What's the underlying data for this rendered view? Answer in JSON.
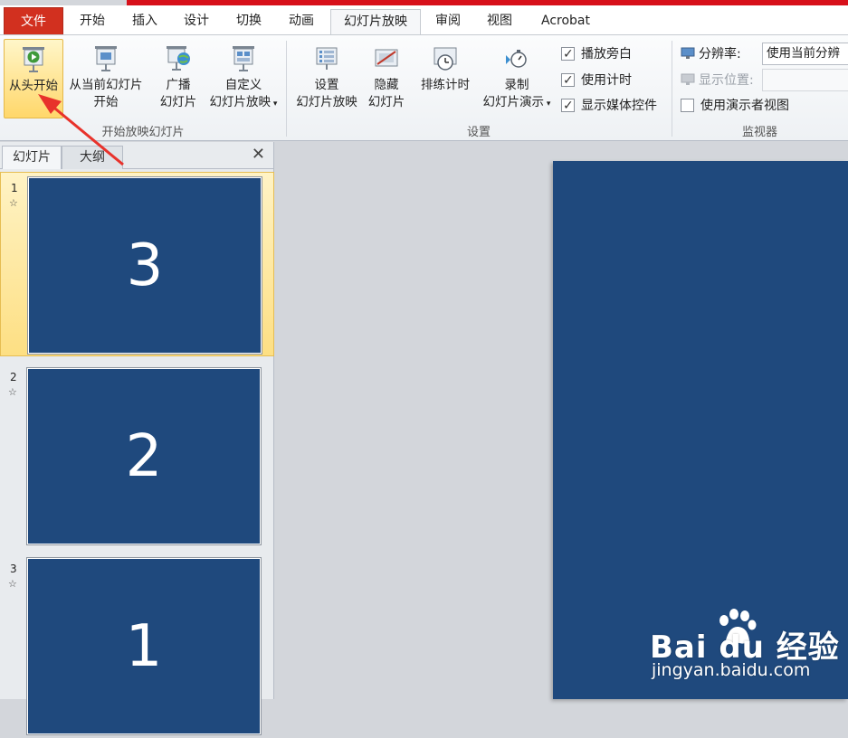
{
  "tabs": [
    "文件",
    "开始",
    "插入",
    "设计",
    "切换",
    "动画",
    "幻灯片放映",
    "审阅",
    "视图",
    "Acrobat"
  ],
  "ribbon": {
    "group_start": {
      "label": "开始放映幻灯片",
      "from_beginning": "从头开始",
      "from_current_l1": "从当前幻灯片",
      "from_current_l2": "开始",
      "broadcast_l1": "广播",
      "broadcast_l2": "幻灯片",
      "custom_l1": "自定义",
      "custom_l2": "幻灯片放映"
    },
    "group_setup": {
      "label": "设置",
      "setup_l1": "设置",
      "setup_l2": "幻灯片放映",
      "hide_l1": "隐藏",
      "hide_l2": "幻灯片",
      "rehearse": "排练计时",
      "record_l1": "录制",
      "record_l2": "幻灯片演示",
      "play_narration": "播放旁白",
      "use_timings": "使用计时",
      "show_media": "显示媒体控件"
    },
    "group_monitor": {
      "label": "监视器",
      "resolution_label": "分辨率:",
      "resolution_value": "使用当前分辨",
      "show_on_label": "显示位置:",
      "presenter_view": "使用演示者视图"
    }
  },
  "panel": {
    "tab_slides": "幻灯片",
    "tab_outline": "大纲",
    "close": "✕",
    "thumbnails": [
      {
        "number": "1",
        "content": "3",
        "selected": true
      },
      {
        "number": "2",
        "content": "2",
        "selected": false
      },
      {
        "number": "3",
        "content": "1",
        "selected": false
      }
    ]
  },
  "watermark": {
    "brand": "Bai  du 经验",
    "url": "jingyan.baidu.com"
  },
  "colors": {
    "accent_red": "#d2301f",
    "slide_blue": "#1f497d",
    "selection": "#fddf83"
  }
}
